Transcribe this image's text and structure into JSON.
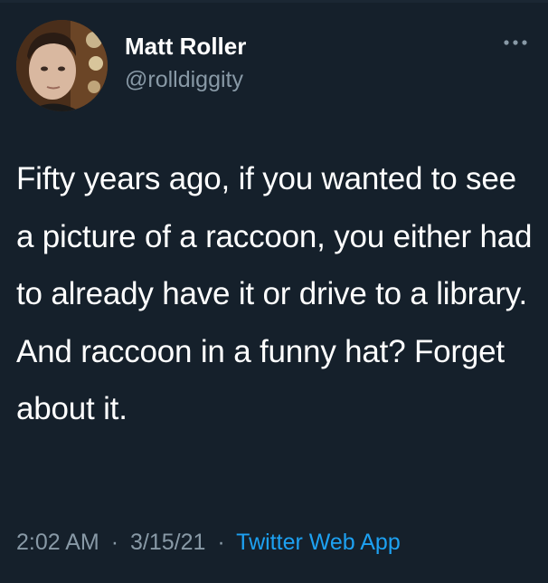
{
  "tweet": {
    "author": {
      "name": "Matt Roller",
      "handle": "@rolldiggity",
      "avatar_icon": "user-avatar-photo"
    },
    "more_icon": "more-options-icon",
    "text": "Fifty years ago, if you wanted to see a picture of a raccoon, you either had to already have it or drive to a library. And raccoon in a funny hat? Forget about it.",
    "meta": {
      "time": "2:02 AM",
      "separator": "·",
      "date": "3/15/21",
      "source": "Twitter Web App"
    }
  },
  "colors": {
    "background": "#15202b",
    "primary_text": "#ffffff",
    "secondary_text": "#8899a6",
    "accent": "#1da1f2"
  }
}
